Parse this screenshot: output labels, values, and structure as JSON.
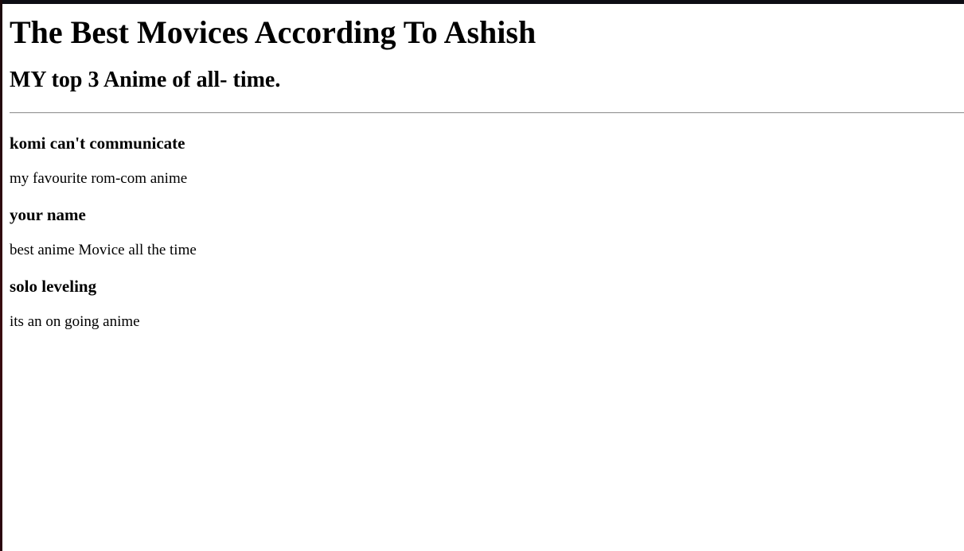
{
  "page": {
    "title": "The Best Movices According To Ashish",
    "subtitle": "MY top 3 Anime of all- time."
  },
  "anime": [
    {
      "name": "komi can't communicate",
      "description": "my favourite rom-com anime"
    },
    {
      "name": "your name",
      "description": "best anime Movice all the time"
    },
    {
      "name": "solo leveling",
      "description": "its an on going anime"
    }
  ]
}
